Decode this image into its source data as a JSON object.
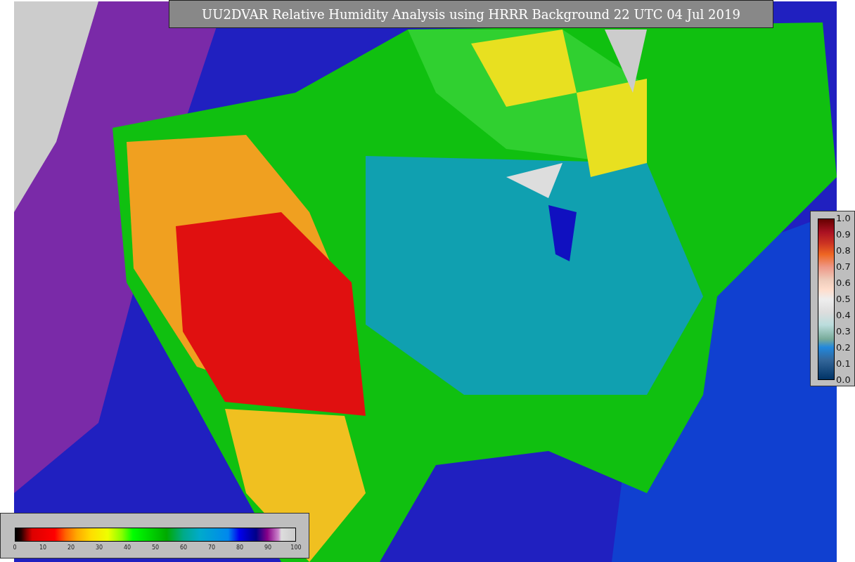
{
  "title": "UU2DVAR Relative Humidity Analysis using HRRR Background 22 UTC 04 Jul 2019",
  "humidity_colorbar": {
    "ticks": [
      "0",
      "10",
      "20",
      "30",
      "40",
      "50",
      "60",
      "70",
      "80",
      "90",
      "100"
    ]
  },
  "station_colorbar": {
    "ticks": [
      "1.0",
      "0.9",
      "0.8",
      "0.7",
      "0.6",
      "0.5",
      "0.4",
      "0.3",
      "0.2",
      "0.1",
      "0.0"
    ]
  }
}
